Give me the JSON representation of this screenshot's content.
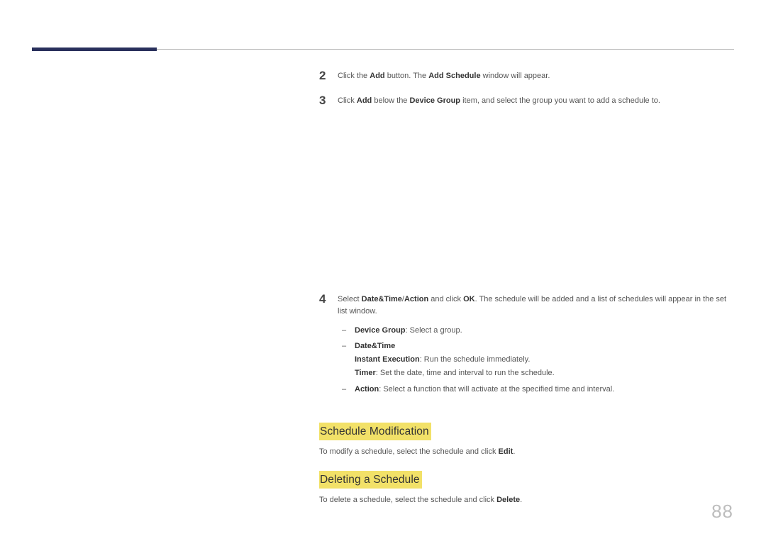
{
  "steps": {
    "s2": {
      "num": "2",
      "pre": "Click the ",
      "b1": "Add",
      "mid": " button. The ",
      "b2": "Add Schedule",
      "post": " window will appear."
    },
    "s3": {
      "num": "3",
      "pre": "Click ",
      "b1": "Add",
      "mid": " below the ",
      "b2": "Device Group",
      "post": " item, and select the group you want to add a schedule to."
    },
    "s4": {
      "num": "4",
      "pre": "Select ",
      "b1": "Date&Time",
      "slash": "/",
      "b2": "Action",
      "mid": " and click ",
      "b3": "OK",
      "post": ". The schedule will be added and a list of schedules will appear in the set list window."
    }
  },
  "sub": {
    "dash": "‒",
    "deviceGroup": {
      "label": "Device Group",
      "rest": ": Select a group."
    },
    "dateTime": {
      "label": "Date&Time"
    },
    "instant": {
      "label": "Instant Execution",
      "rest": ": Run the schedule immediately."
    },
    "timer": {
      "label": "Timer",
      "rest": ": Set the date, time and interval to run the schedule."
    },
    "action": {
      "label": "Action",
      "rest": ": Select a function that will activate at the specified time and interval."
    }
  },
  "sections": {
    "mod": {
      "title": "Schedule Modification",
      "pre": "To modify a schedule, select the schedule and click ",
      "b": "Edit",
      "post": "."
    },
    "del": {
      "title": "Deleting a Schedule",
      "pre": "To delete a schedule, select the schedule and click ",
      "b": "Delete",
      "post": "."
    }
  },
  "pageNumber": "88"
}
